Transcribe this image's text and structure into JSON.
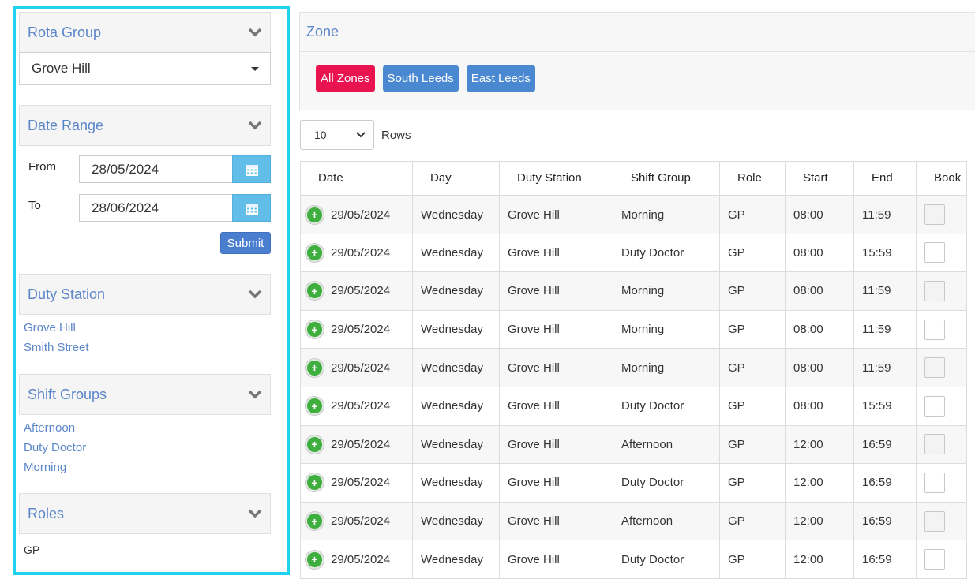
{
  "sidebar": {
    "rota_group": {
      "title": "Rota Group",
      "selected": "Grove Hill"
    },
    "date_range": {
      "title": "Date Range",
      "from_label": "From",
      "from_value": "28/05/2024",
      "to_label": "To",
      "to_value": "28/06/2024",
      "submit_label": "Submit"
    },
    "duty_station": {
      "title": "Duty Station",
      "items": [
        "Grove Hill",
        "Smith Street"
      ]
    },
    "shift_groups": {
      "title": "Shift Groups",
      "items": [
        "Afternoon",
        "Duty Doctor",
        "Morning"
      ]
    },
    "roles": {
      "title": "Roles",
      "items": [
        "GP"
      ]
    }
  },
  "zone": {
    "title": "Zone",
    "buttons": [
      {
        "label": "All Zones",
        "color": "#e8134f"
      },
      {
        "label": "South Leeds",
        "color": "#4a89d2"
      },
      {
        "label": "East Leeds",
        "color": "#4a89d2"
      }
    ]
  },
  "rows": {
    "value": "10",
    "label": "Rows"
  },
  "table": {
    "headers": [
      "Date",
      "Day",
      "Duty Station",
      "Shift Group",
      "Role",
      "Start",
      "End",
      "Book"
    ],
    "rows": [
      [
        "29/05/2024",
        "Wednesday",
        "Grove Hill",
        "Morning",
        "GP",
        "08:00",
        "11:59"
      ],
      [
        "29/05/2024",
        "Wednesday",
        "Grove Hill",
        "Duty Doctor",
        "GP",
        "08:00",
        "15:59"
      ],
      [
        "29/05/2024",
        "Wednesday",
        "Grove Hill",
        "Morning",
        "GP",
        "08:00",
        "11:59"
      ],
      [
        "29/05/2024",
        "Wednesday",
        "Grove Hill",
        "Morning",
        "GP",
        "08:00",
        "11:59"
      ],
      [
        "29/05/2024",
        "Wednesday",
        "Grove Hill",
        "Morning",
        "GP",
        "08:00",
        "11:59"
      ],
      [
        "29/05/2024",
        "Wednesday",
        "Grove Hill",
        "Duty Doctor",
        "GP",
        "08:00",
        "15:59"
      ],
      [
        "29/05/2024",
        "Wednesday",
        "Grove Hill",
        "Afternoon",
        "GP",
        "12:00",
        "16:59"
      ],
      [
        "29/05/2024",
        "Wednesday",
        "Grove Hill",
        "Duty Doctor",
        "GP",
        "12:00",
        "16:59"
      ],
      [
        "29/05/2024",
        "Wednesday",
        "Grove Hill",
        "Afternoon",
        "GP",
        "12:00",
        "16:59"
      ],
      [
        "29/05/2024",
        "Wednesday",
        "Grove Hill",
        "Duty Doctor",
        "GP",
        "12:00",
        "16:59"
      ]
    ]
  },
  "colors": {
    "accent": "#5b86c9",
    "highlight_border": "#1fd3ee",
    "add_icon": "#3eae3e"
  }
}
